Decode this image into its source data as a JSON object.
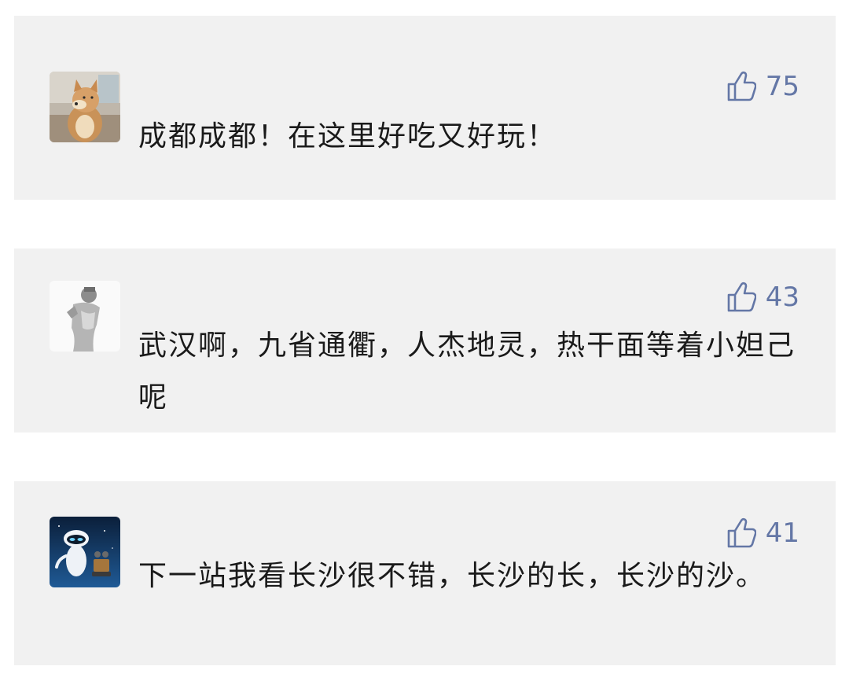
{
  "comments": [
    {
      "avatar_icon": "shiba-dog-avatar",
      "likes": "75",
      "text": "成都成都！在这里好吃又好玩！"
    },
    {
      "avatar_icon": "sketch-figure-avatar",
      "likes": "43",
      "text": "武汉啊，九省通衢，人杰地灵，热干面等着小妲己呢"
    },
    {
      "avatar_icon": "robot-avatar",
      "likes": "41",
      "text": "下一站我看长沙很不错，长沙的长，长沙的沙。"
    }
  ],
  "colors": {
    "card_background": "#f1f1f1",
    "like_color": "#6477a6",
    "text_color": "#1a1a1a"
  }
}
